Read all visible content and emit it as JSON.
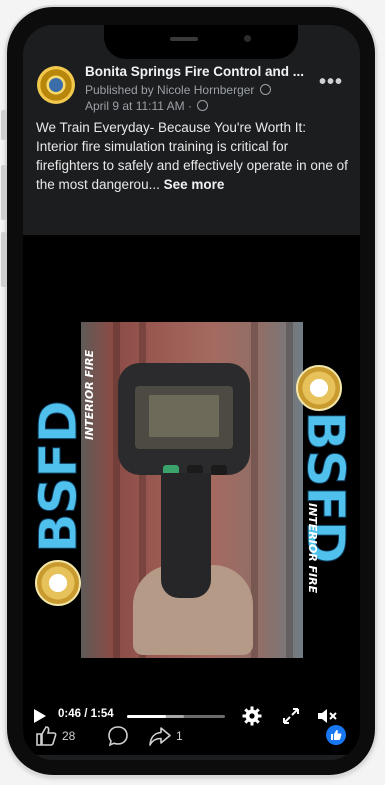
{
  "post": {
    "page_name": "Bonita Springs Fire Control and ...",
    "published_by": "Published by Nicole Hornberger",
    "date": "April 9 at 11:11 AM ·",
    "text": "We Train Everyday- Because You're Worth It: Interior fire simulation training is critical for firefighters to safely and effectively operate in one of the most dangerou...",
    "see_more": "See more"
  },
  "video": {
    "overlay_brand": "BSFD",
    "overlay_sub": "INTERIOR FIRE",
    "time": "0:46 / 1:54",
    "progress": 0.4,
    "buffered": 0.58
  },
  "actions": {
    "likes": "28",
    "shares": "1"
  },
  "colors": {
    "brand_blue": "#4fc1ec",
    "facebook_blue": "#1877f2"
  },
  "icons": [
    "more-options-icon",
    "play-icon",
    "settings-gear-icon",
    "fullscreen-icon",
    "mute-icon",
    "like-icon",
    "comment-icon",
    "share-icon",
    "like-reaction-icon"
  ]
}
